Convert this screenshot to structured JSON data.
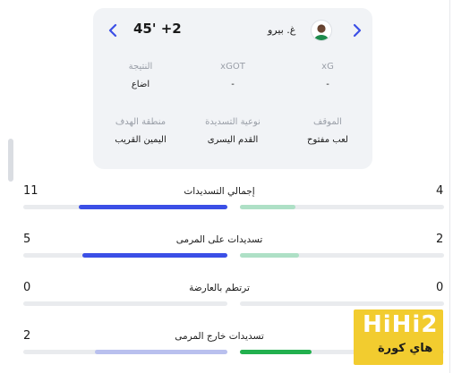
{
  "shot": {
    "minute": "45' +2",
    "player": "غ. بيرو",
    "stats_top": [
      {
        "label": "النتيجة",
        "value": "اضاع"
      },
      {
        "label": "xGOT",
        "value": "-"
      },
      {
        "label": "xG",
        "value": "-"
      }
    ],
    "stats_bottom": [
      {
        "label": "منطقة الهدف",
        "value": "اليمين القريب"
      },
      {
        "label": "نوعية التسديدة",
        "value": "القدم اليسرى"
      },
      {
        "label": "الموقف",
        "value": "لعب مفتوح"
      }
    ]
  },
  "rows": [
    {
      "title": "إجمالي التسديدات",
      "left": "11",
      "right": "4",
      "left_fraction": 0.73,
      "right_fraction": 0.27
    },
    {
      "title": "تسديدات على المرمى",
      "left": "5",
      "right": "2",
      "left_fraction": 0.71,
      "right_fraction": 0.29
    },
    {
      "title": "ترتطم بالعارضة",
      "left": "0",
      "right": "0",
      "left_fraction": 0,
      "right_fraction": 0
    },
    {
      "title": "تسديدات خارج المرمى",
      "left": "2",
      "right": "",
      "left_fraction": 0.65,
      "right_fraction": 0.35
    }
  ],
  "watermark": {
    "big": "HiHi2",
    "small": "هاي كورة"
  },
  "colors": {
    "home": "#3b4fe6",
    "away": "#aee0c6",
    "home_light": "#b9c0ee",
    "away_strong": "#22b04e",
    "card_bg": "#f1f3f6",
    "track": "#e9ebee",
    "watermark": "#f2cc2f"
  }
}
